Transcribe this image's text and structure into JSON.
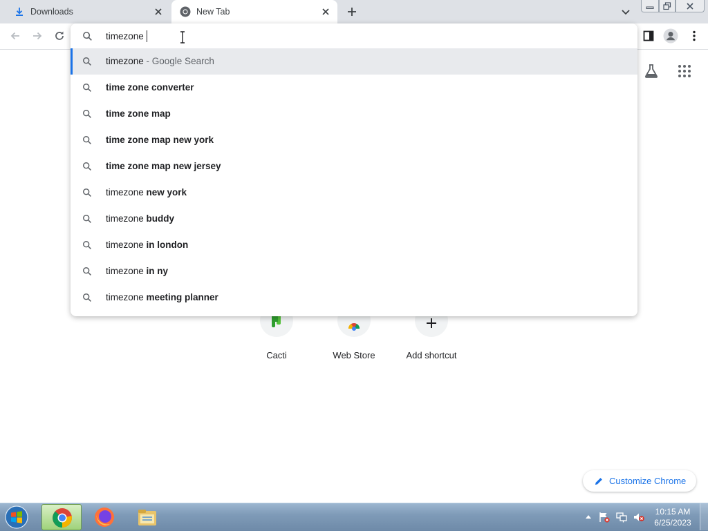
{
  "tabs": [
    {
      "title": "Downloads",
      "icon": "download-icon",
      "active": false
    },
    {
      "title": "New Tab",
      "icon": "chrome-icon",
      "active": true
    }
  ],
  "omnibox": {
    "value": "timezone",
    "suggestions": [
      {
        "plain": "timezone",
        "bold": "",
        "dim": " - Google Search",
        "selected": true
      },
      {
        "plain": "",
        "bold": "time zone converter",
        "dim": ""
      },
      {
        "plain": "",
        "bold": "time zone map",
        "dim": ""
      },
      {
        "plain": "",
        "bold": "time zone map new york",
        "dim": ""
      },
      {
        "plain": "",
        "bold": "time zone map new jersey",
        "dim": ""
      },
      {
        "plain": "timezone ",
        "bold": "new york",
        "dim": ""
      },
      {
        "plain": "timezone ",
        "bold": "buddy",
        "dim": ""
      },
      {
        "plain": "timezone ",
        "bold": "in london",
        "dim": ""
      },
      {
        "plain": "timezone ",
        "bold": "in ny",
        "dim": ""
      },
      {
        "plain": "timezone ",
        "bold": "meeting planner",
        "dim": ""
      }
    ]
  },
  "shortcuts": [
    {
      "label": "Cacti",
      "icon": "cacti-icon"
    },
    {
      "label": "Web Store",
      "icon": "web-store-icon"
    },
    {
      "label": "Add shortcut",
      "icon": "plus-icon"
    }
  ],
  "customize": {
    "label": "Customize Chrome"
  },
  "taskbar": {
    "apps": [
      "chrome-icon",
      "firefox-icon",
      "file-explorer-icon"
    ],
    "clock_time": "10:15 AM",
    "clock_date": "6/25/2023"
  },
  "colors": {
    "accent": "#1a73e8",
    "selected_row": "#e8eaed",
    "tab_strip": "#dee1e6"
  }
}
